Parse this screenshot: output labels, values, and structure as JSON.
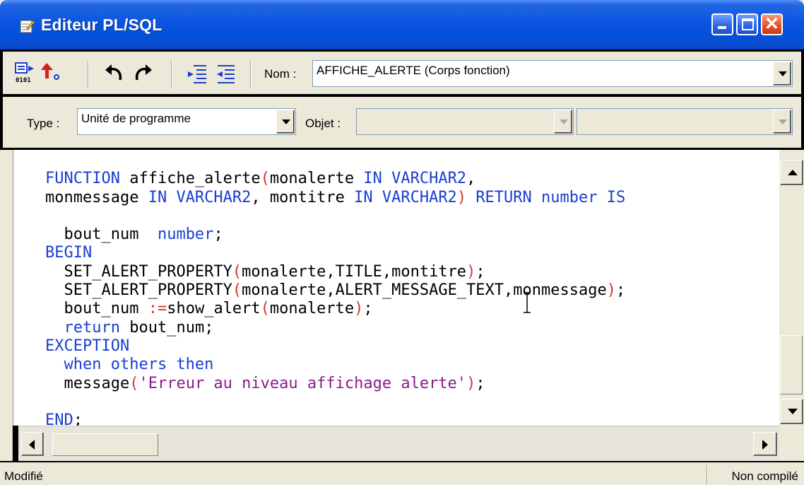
{
  "window": {
    "title": "Editeur PL/SQL",
    "title_icon": "edit-document-icon",
    "controls": [
      "minimize-icon",
      "maximize-icon",
      "close-icon"
    ]
  },
  "toolbar1": {
    "buttons": [
      {
        "name": "compile-button",
        "icon": "compile-binary-icon"
      },
      {
        "name": "revert-button",
        "icon": "red-arrow-icon"
      },
      {
        "name": "undo-button",
        "icon": "undo-icon"
      },
      {
        "name": "redo-button",
        "icon": "redo-icon"
      },
      {
        "name": "indent-button",
        "icon": "indent-icon"
      },
      {
        "name": "outdent-button",
        "icon": "outdent-icon"
      }
    ],
    "name_label": "Nom :",
    "name_value": "AFFICHE_ALERTE (Corps fonction)"
  },
  "toolbar2": {
    "type_label": "Type :",
    "type_value": "Unité de programme",
    "object_label": "Objet :",
    "object_value": "",
    "object_value2": ""
  },
  "editor": {
    "language": "PL/SQL",
    "lines": [
      "FUNCTION affiche_alerte(monalerte IN VARCHAR2,",
      "monmessage IN VARCHAR2, montitre IN VARCHAR2) RETURN number IS",
      "",
      "  bout_num  number;",
      "BEGIN",
      "  SET_ALERT_PROPERTY(monalerte,TITLE,montitre);",
      "  SET_ALERT_PROPERTY(monalerte,ALERT_MESSAGE_TEXT,monmessage);",
      "  bout_num :=show_alert(monalerte);",
      "  return bout_num;",
      "EXCEPTION",
      "  when others then",
      "  message('Erreur au niveau affichage alerte');",
      "",
      "END;"
    ]
  },
  "colors": {
    "keyword": "#1a3fd0",
    "operator": "#e03030",
    "string": "#8a1c8a",
    "titlebar": "#0a55e1"
  },
  "status": {
    "left": "Modifié",
    "right": "Non compilé"
  }
}
